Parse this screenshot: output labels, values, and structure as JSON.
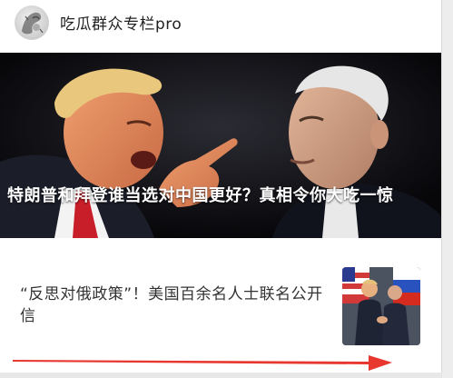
{
  "header": {
    "channel_name": "吃瓜群众专栏pro",
    "avatar_icon": "ink-painting-avatar-icon"
  },
  "hero": {
    "title": "特朗普和拜登谁当选对中国更好？真相令你大吃一惊",
    "image_icon": "trump-biden-photo"
  },
  "article": {
    "title": "“反思对俄政策”！美国百余名人士联名公开信",
    "thumbnail_icon": "handshake-photo"
  },
  "annotation": {
    "arrow_color": "#e8372f"
  }
}
